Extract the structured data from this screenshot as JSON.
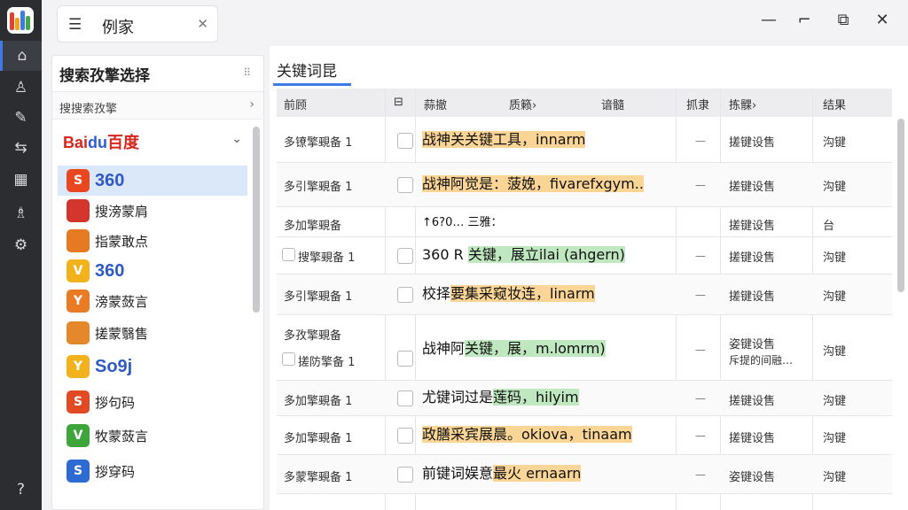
{
  "app": {
    "tab_title": "例家",
    "menu_icon": "hamburger-icon",
    "close_icon": "close-icon"
  },
  "window_controls": [
    "minimize-icon",
    "pin-icon",
    "restore-icon",
    "close-icon"
  ],
  "rail_icons": [
    "home-icon",
    "user-icon",
    "brush-icon",
    "translate-icon",
    "grid-icon",
    "user-switch-icon",
    "gear-icon",
    "help-icon"
  ],
  "left_panel": {
    "title": "搜索孜擎选择",
    "subhead": "搜搜索孜擎",
    "subhead_chevron": "›",
    "baidu_label_red": "Bai",
    "baidu_label_blue": "du",
    "baidu_label_cn": "百度",
    "engines": [
      {
        "label": "360",
        "badge_text": "S",
        "badge_color": "#e8471f",
        "big": true,
        "selected": true
      },
      {
        "label": "搜滂蒙肩",
        "badge_text": "",
        "badge_color": "#d4352c",
        "big": false
      },
      {
        "label": "指蒙敢点",
        "badge_text": "",
        "badge_color": "#e67a22",
        "big": false
      },
      {
        "label": "360",
        "badge_text": "V",
        "badge_color": "#f1b21b",
        "big": true
      },
      {
        "label": "滂蒙蔹言",
        "badge_text": "Y",
        "badge_color": "#ea7b24",
        "big": false
      },
      {
        "label": "搓蒙翳售",
        "badge_text": "",
        "badge_color": "#e5882c",
        "big": false
      },
      {
        "label": "So9j",
        "badge_text": "Y",
        "badge_color": "#f1b21b",
        "big": true
      },
      {
        "label": "拶句码",
        "badge_text": "S",
        "badge_color": "#e14a25",
        "big": false
      },
      {
        "label": "牧蒙蔹言",
        "badge_text": "V",
        "badge_color": "#3ea53a",
        "big": false
      },
      {
        "label": "拶穿码",
        "badge_text": "S",
        "badge_color": "#2d6bd3",
        "big": false
      }
    ]
  },
  "right_panel": {
    "tab": "关键词昆",
    "columns": [
      "前顾",
      "",
      "蒜撤",
      "质籁›",
      "谙髓",
      "抓隶",
      "拣髁›",
      "结果"
    ],
    "rows": [
      {
        "c1": "多镣擎覡备 1",
        "kw_o": "战神关关键工具，",
        "kw_g": "",
        "kw_tail": "innarm",
        "c6": "—",
        "c7": "搓键设售",
        "c8": "沟键"
      },
      {
        "c1": "多引擎覡备 1",
        "kw_o": "战神阿觉是：菠娩，fivarefxgym..",
        "kw_g": "",
        "kw_tail": "",
        "c6": "—",
        "c7": "搓键设售",
        "c8": "沟键"
      },
      {
        "c1": "多加擎覡备",
        "kw_o": "",
        "kw_g": "",
        "kw_tail": "↑6?0…   三雅：",
        "c6": "",
        "c7": "搓键设售",
        "c8": "台"
      },
      {
        "c1": "搜擎覡备 1",
        "kw_o": "",
        "kw_g": "关键，展立ilai (ahgern)",
        "kw_tail": "360 R ",
        "c6": "—",
        "c7": "搓键设售",
        "c8": "沟键"
      },
      {
        "c1": "多引擎覡备 1",
        "kw_o": "要集采窥妆连，linarm",
        "kw_g": "",
        "kw_tail": "校择",
        "c6": "—",
        "c7": "搓键设售",
        "c8": "沟键"
      },
      {
        "c1": "多孜擎覡备",
        "c1b": "搓防擎备 1",
        "kw_o": "",
        "kw_g": "关键，展，m.lomrm)",
        "kw_tail": "战神阿",
        "c6": "—",
        "c7": "姿键设售",
        "c7b": "斥提的间融…",
        "c8": "沟键"
      },
      {
        "c1": "多加擎覡备 1",
        "kw_o": "",
        "kw_g": "莲码，hilyim",
        "kw_tail": "尤键词过是",
        "c6": "—",
        "c7": "搓键设售",
        "c8": "沟键"
      },
      {
        "c1": "多加擎覡备 1",
        "kw_o": "政膳采宾展晨。okiova，tinaam",
        "kw_g": "",
        "kw_tail": "",
        "c6": "—",
        "c7": "搓键设售",
        "c8": "沟键"
      },
      {
        "c1": "多蒙擎覡备 1",
        "kw_o": "最火 ernaarn",
        "kw_g": "",
        "kw_tail": "前键词娱意",
        "c6": "—",
        "c7": "姿键设售",
        "c8": "沟键"
      }
    ]
  }
}
